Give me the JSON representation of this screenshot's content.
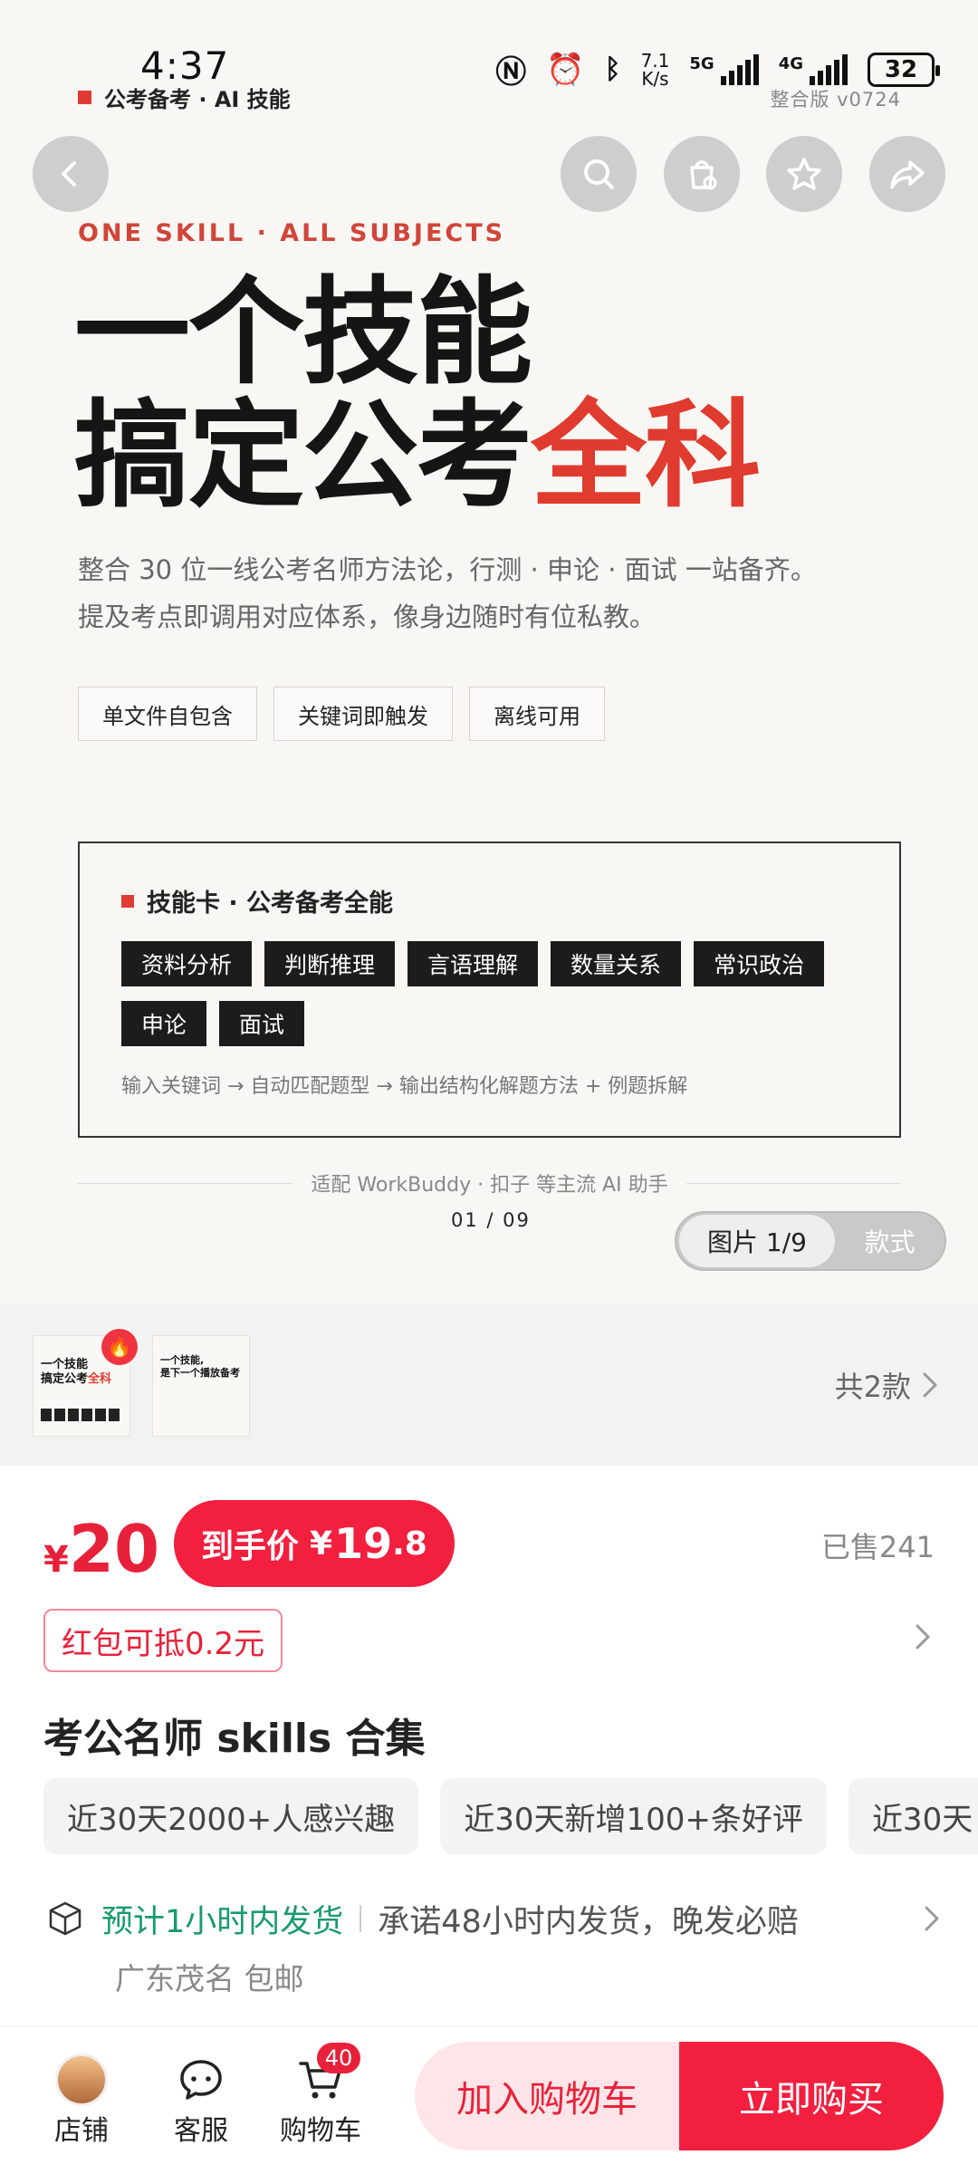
{
  "status_bar": {
    "time": "4:37",
    "net_speed_top": "7.1",
    "net_speed_bottom": "K/s",
    "sim1": "5G",
    "sim2": "4G",
    "battery": "32",
    "version": "整合版 v0724"
  },
  "hero": {
    "brand": "公考备考 · AI 技能",
    "eyebrow": "ONE SKILL · ALL SUBJECTS",
    "headline_line1": "一个技能",
    "headline_line2_main": "搞定公考",
    "headline_line2_accent": "全科",
    "description": "整合 30 位一线公考名师方法论，行测 · 申论 · 面试 一站备齐。提及考点即调用对应体系，像身边随时有位私教。",
    "chips": [
      "单文件自包含",
      "关键词即触发",
      "离线可用"
    ],
    "card": {
      "title": "技能卡 · 公考备考全能",
      "tags": [
        "资料分析",
        "判断推理",
        "言语理解",
        "数量关系",
        "常识政治",
        "申论",
        "面试"
      ],
      "flow": "输入关键词 → 自动匹配题型 → 输出结构化解题方法 + 例题拆解"
    },
    "compat": "适配 WorkBuddy · 扣子 等主流 AI 助手",
    "pager": "01 / 09",
    "toggle_active": "图片 1/9",
    "toggle_inactive": "款式"
  },
  "variants": {
    "thumb1_line1": "一个技能",
    "thumb1_line2_main": "搞定公考",
    "thumb1_line2_accent": "全科",
    "thumb2_line1": "一个技能,",
    "thumb2_line2": "是下一个播放备考",
    "count": "共2款"
  },
  "product": {
    "currency": "¥",
    "price": "20",
    "final_label": "到手价",
    "final_currency": "¥",
    "final_int": "19",
    "final_dec": ".8",
    "sold": "已售241",
    "coupon": "红包可抵0.2元",
    "title": "考公名师 skills 合集",
    "stats": [
      "近30天2000+人感兴趣",
      "近30天新增100+条好评",
      "近30天"
    ],
    "shipping_highlight": "预计1小时内发货",
    "shipping_promise": "承诺48小时内发货，晚发必赔",
    "location": "广东茂名 包邮"
  },
  "bottom_nav": {
    "shop": "店铺",
    "service": "客服",
    "cart": "购物车",
    "cart_badge": "40",
    "add_to_cart": "加入购物车",
    "buy_now": "立即购买"
  },
  "colors": {
    "accent_red": "#e8213a",
    "headline_red": "#e03b2f",
    "shipping_green": "#179b6b"
  },
  "icons": [
    "back-icon",
    "search-icon",
    "bag-icon",
    "star-icon",
    "share-icon",
    "fire-icon",
    "chevron-right-icon",
    "package-icon",
    "chat-icon",
    "cart-icon"
  ]
}
